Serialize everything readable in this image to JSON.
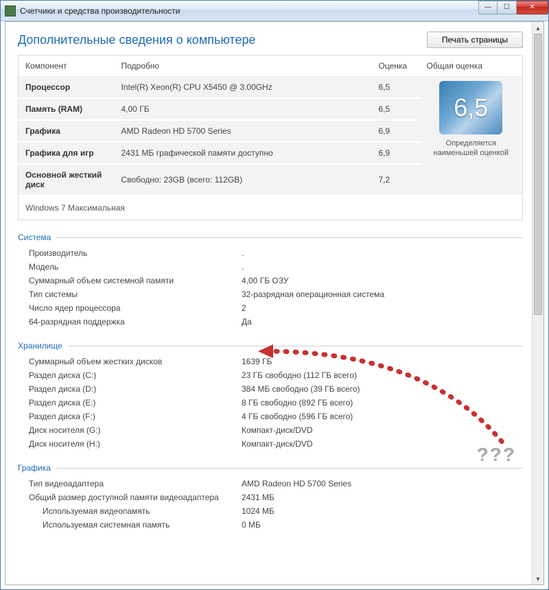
{
  "window": {
    "title": "Счетчики и средства производительности"
  },
  "header": {
    "heading": "Дополнительные сведения о компьютере",
    "print_btn": "Печать страницы"
  },
  "table": {
    "col_component": "Компонент",
    "col_detail": "Подробно",
    "col_score": "Оценка",
    "col_base": "Общая оценка",
    "rows": [
      {
        "label": "Процессор",
        "detail": "Intel(R) Xeon(R) CPU X5450 @ 3.00GHz",
        "score": "6,5"
      },
      {
        "label": "Память (RAM)",
        "detail": "4,00 ГБ",
        "score": "6,5"
      },
      {
        "label": "Графика",
        "detail": "AMD Radeon HD 5700 Series",
        "score": "6,9"
      },
      {
        "label": "Графика для игр",
        "detail": "2431 МБ графической памяти доступно",
        "score": "6,9"
      },
      {
        "label": "Основной жесткий диск",
        "detail": "Свободно: 23GB (всего: 112GB)",
        "score": "7,2"
      }
    ],
    "badge_score": "6,5",
    "badge_caption": "Определяется наименьшей оценкой",
    "os_label": "Windows 7 Максимальная"
  },
  "sections": {
    "system": {
      "title": "Система",
      "rows": [
        {
          "k": "Производитель",
          "v": "."
        },
        {
          "k": "Модель",
          "v": "."
        },
        {
          "k": "Суммарный объем системной памяти",
          "v": "4,00 ГБ ОЗУ"
        },
        {
          "k": "Тип системы",
          "v": "32-разрядная операционная система"
        },
        {
          "k": "Число ядер процессора",
          "v": "2"
        },
        {
          "k": "64-разрядная поддержка",
          "v": "Да"
        }
      ]
    },
    "storage": {
      "title": "Хранилище",
      "rows": [
        {
          "k": "Суммарный объем жестких дисков",
          "v": "1639 ГБ"
        },
        {
          "k": "Раздел диска (C:)",
          "v": "23 ГБ свободно (112 ГБ всего)"
        },
        {
          "k": "Раздел диска (D:)",
          "v": "384 МБ свободно (39 ГБ всего)"
        },
        {
          "k": "Раздел диска (E:)",
          "v": "8 ГБ свободно (892 ГБ всего)"
        },
        {
          "k": "Раздел диска (F:)",
          "v": "4 ГБ свободно (596 ГБ всего)"
        },
        {
          "k": "Диск носителя (G:)",
          "v": "Компакт-диск/DVD"
        },
        {
          "k": "Диск носителя (H:)",
          "v": "Компакт-диск/DVD"
        }
      ]
    },
    "graphics": {
      "title": "Графика",
      "rows": [
        {
          "k": "Тип видеоадаптера",
          "v": "AMD Radeon HD 5700 Series"
        },
        {
          "k": "Общий размер доступной памяти видеоадаптера",
          "v": "2431 МБ"
        }
      ],
      "sub": [
        {
          "k": "Используемая видеопамять",
          "v": "1024 МБ"
        },
        {
          "k": "Используемая системная память",
          "v": "0 МБ"
        }
      ]
    }
  },
  "annotation": {
    "qmarks": "???"
  }
}
